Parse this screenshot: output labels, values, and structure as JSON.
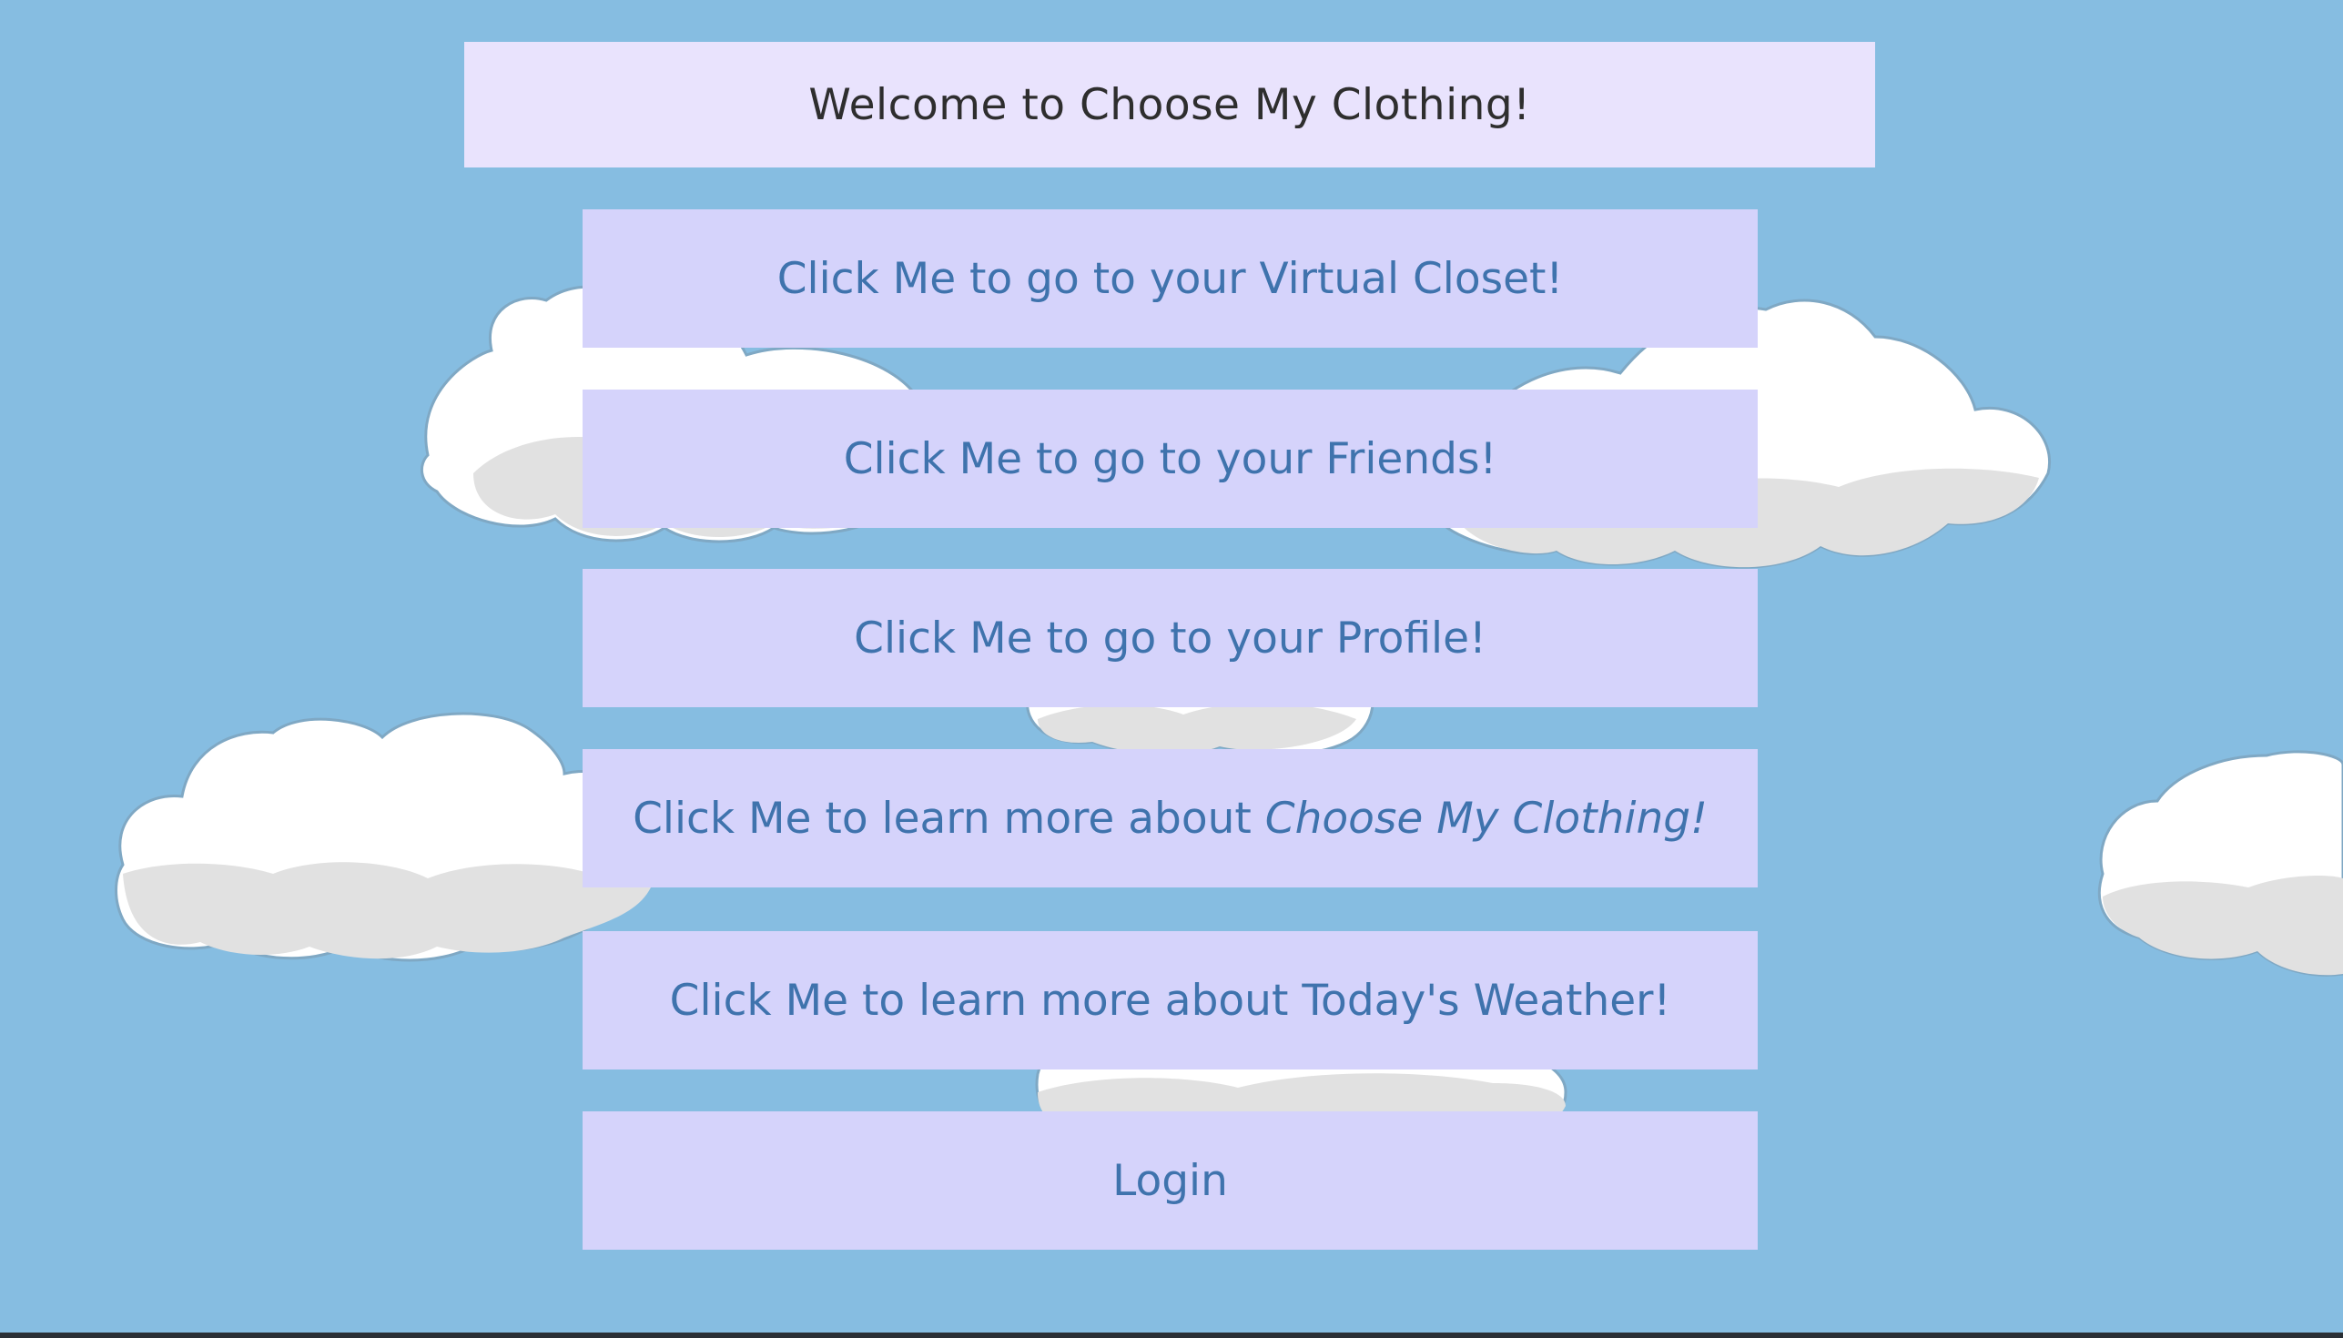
{
  "page": {
    "background_color": "#86bde1",
    "cloud_color": "#ffffff",
    "cloud_shadow_color": "#e0e0e0"
  },
  "header": {
    "title": "Welcome to Choose My Clothing!"
  },
  "nav": {
    "virtual_closet_label": "Click Me to go to your Virtual Closet!",
    "friends_label": "Click Me to go to your Friends!",
    "profile_label": "Click Me to go to your Profile!",
    "about_prefix": "Click Me to learn more about ",
    "about_brand": "Choose My Clothing!",
    "weather_label": "Click Me to learn more about Today's Weather!",
    "login_label": "Login"
  },
  "colors": {
    "title_bg": "#e9e3fd",
    "button_bg": "#d5d3fb",
    "button_text": "#3f73ad",
    "title_text": "#2e2e2e"
  }
}
